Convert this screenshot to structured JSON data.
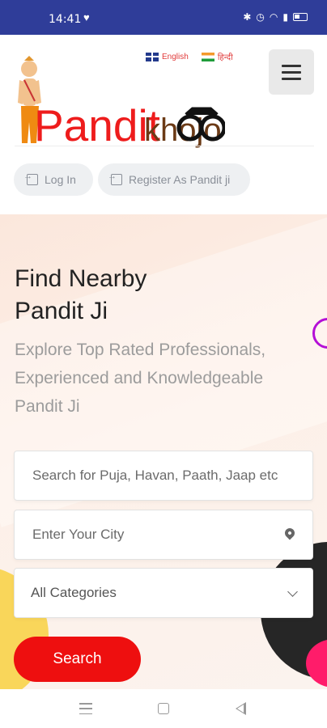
{
  "status_bar": {
    "time": "14:41"
  },
  "header": {
    "languages": [
      "English",
      "हिन्दी"
    ],
    "logo_text": {
      "left": "Pandit",
      "right": "khojo"
    },
    "login_label": "Log In",
    "register_label": "Register As Pandit ji"
  },
  "hero": {
    "title_lines": [
      "Find Nearby",
      "Pandit Ji"
    ],
    "subtitle_lines": [
      "Explore Top Rated Professionals,",
      "Experienced and Knowledgeable",
      "Pandit Ji"
    ],
    "search_placeholder": "Search for Puja, Havan, Paath, Jaap etc",
    "city_placeholder": "Enter Your City",
    "category_selected": "All Categories",
    "search_button": "Search"
  },
  "colors": {
    "status_bar": "#2f3d99",
    "brand_red": "#ee0f0f",
    "logo_brown": "#6b3a16",
    "accent_purple": "#b40fd6"
  }
}
